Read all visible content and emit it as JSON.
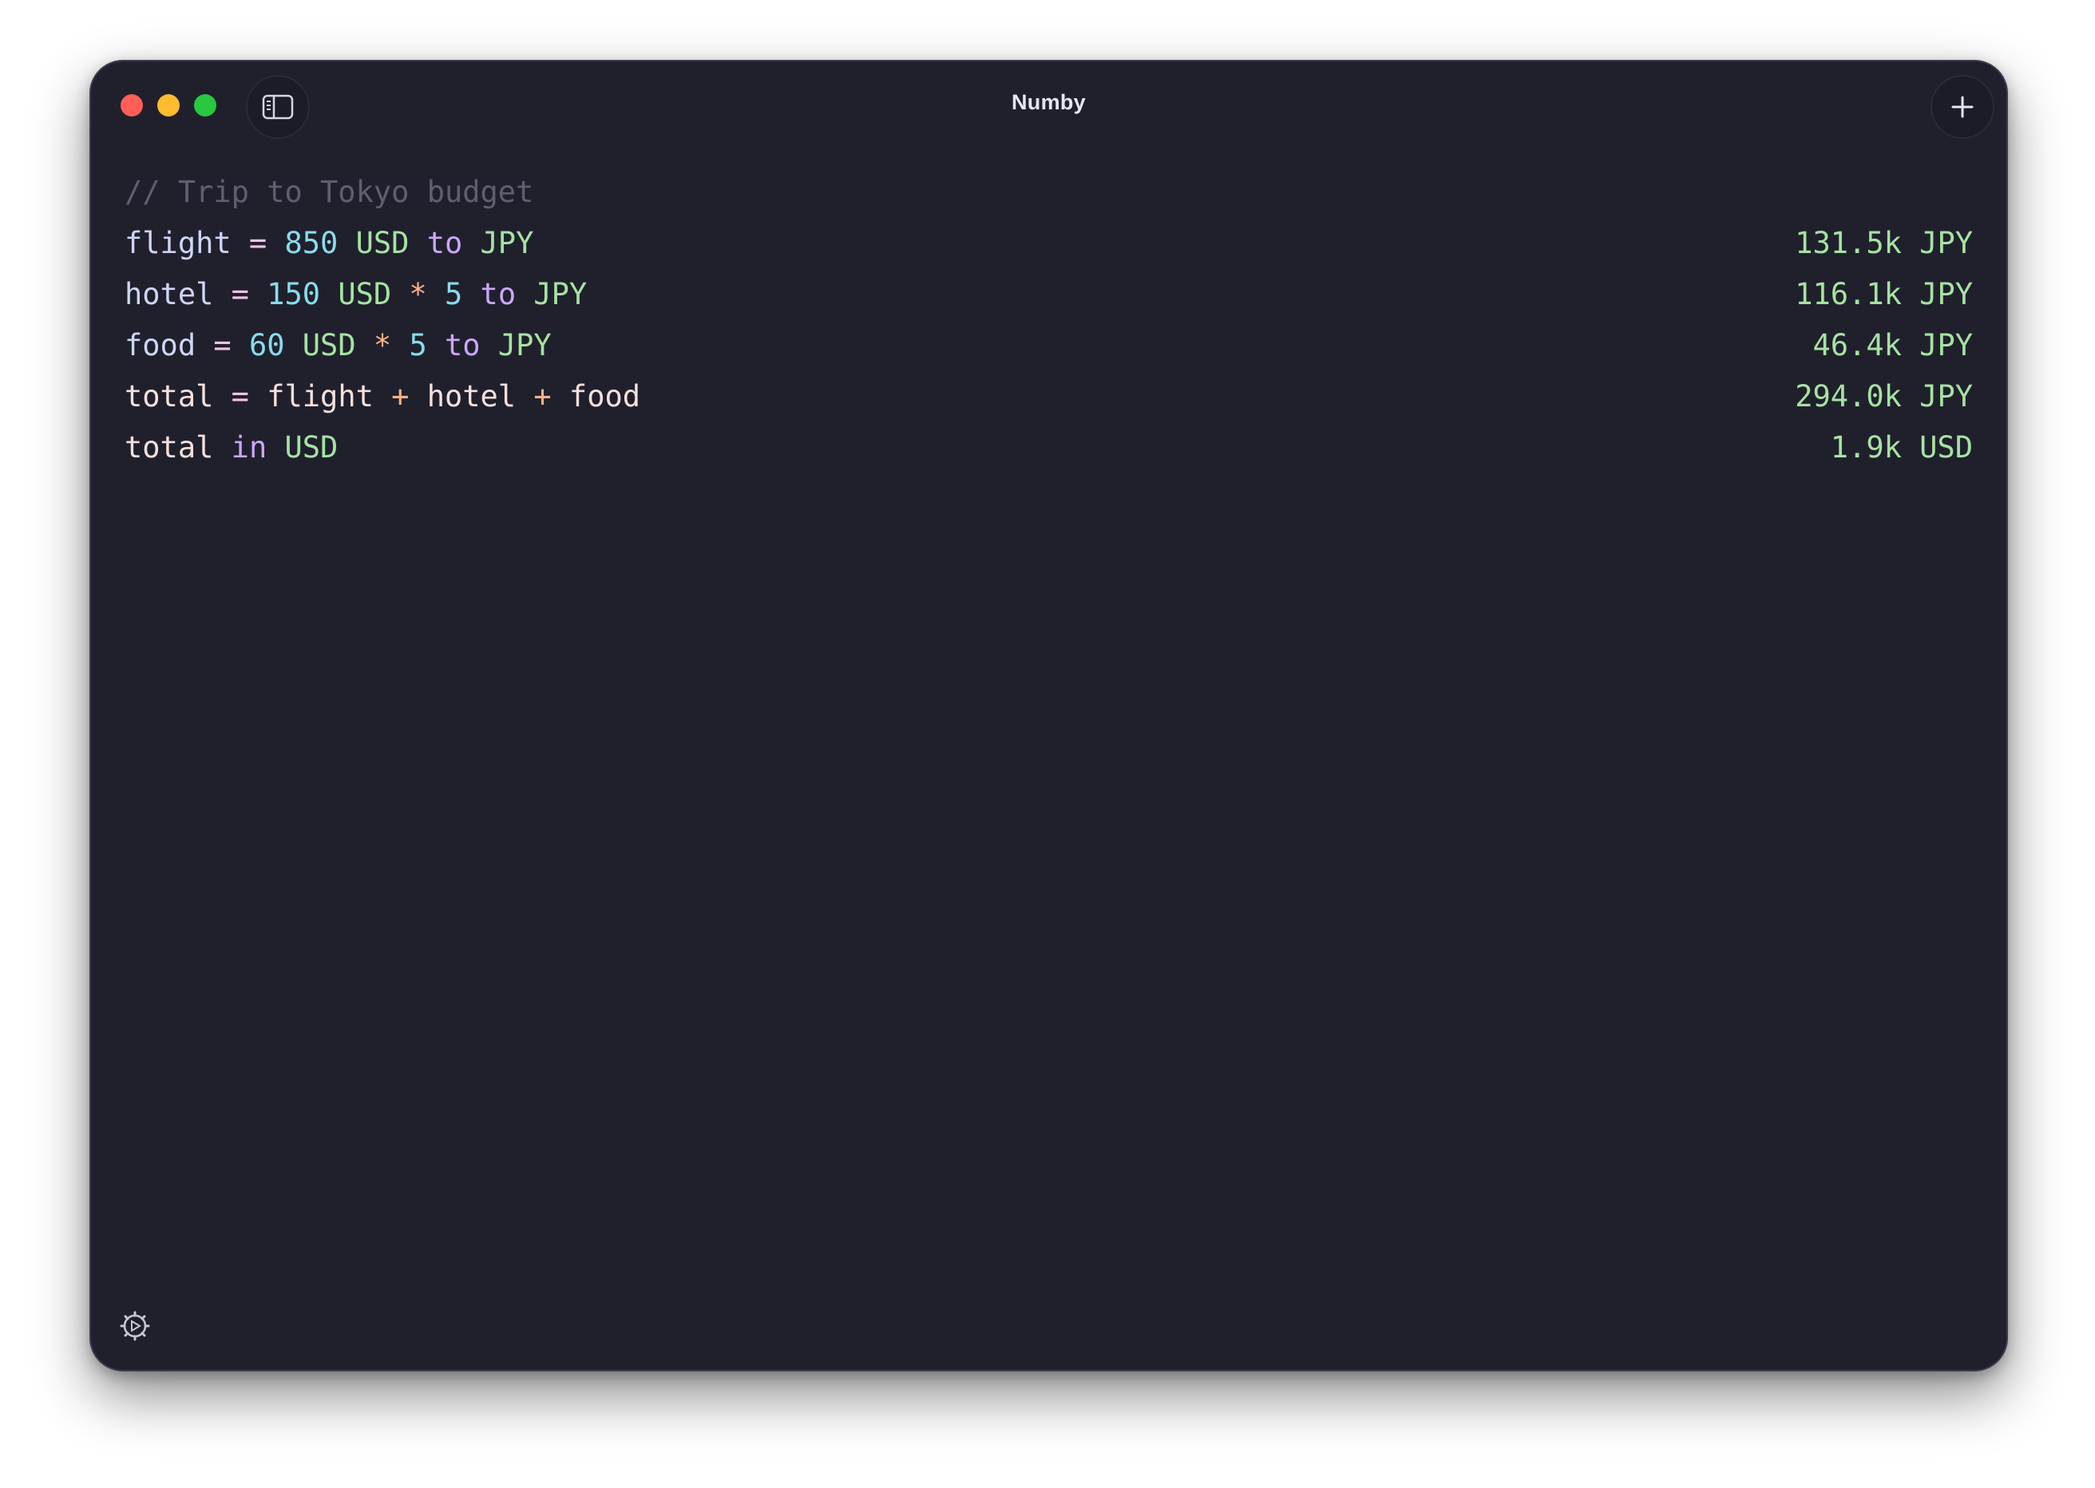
{
  "window": {
    "title": "Numby"
  },
  "editor": {
    "comment": "// Trip to Tokyo budget",
    "lines": [
      {
        "tokens": [
          {
            "t": "flight",
            "c": "var"
          },
          {
            "t": " = ",
            "c": "eq"
          },
          {
            "t": "850",
            "c": "num"
          },
          {
            "t": " USD",
            "c": "unit"
          },
          {
            "t": " to",
            "c": "kw"
          },
          {
            "t": " JPY",
            "c": "unit"
          }
        ],
        "result": "131.5k JPY"
      },
      {
        "tokens": [
          {
            "t": "hotel",
            "c": "var"
          },
          {
            "t": " = ",
            "c": "eq"
          },
          {
            "t": "150",
            "c": "num"
          },
          {
            "t": " USD",
            "c": "unit"
          },
          {
            "t": " * ",
            "c": "op"
          },
          {
            "t": "5",
            "c": "num"
          },
          {
            "t": " to",
            "c": "kw"
          },
          {
            "t": " JPY",
            "c": "unit"
          }
        ],
        "result": "116.1k JPY"
      },
      {
        "tokens": [
          {
            "t": "food",
            "c": "var"
          },
          {
            "t": " = ",
            "c": "eq"
          },
          {
            "t": "60",
            "c": "num"
          },
          {
            "t": " USD",
            "c": "unit"
          },
          {
            "t": " * ",
            "c": "op"
          },
          {
            "t": "5",
            "c": "num"
          },
          {
            "t": " to",
            "c": "kw"
          },
          {
            "t": " JPY",
            "c": "unit"
          }
        ],
        "result": "46.4k JPY"
      },
      {
        "tokens": [
          {
            "t": "total",
            "c": "var2"
          },
          {
            "t": " = ",
            "c": "eq"
          },
          {
            "t": "flight",
            "c": "var2"
          },
          {
            "t": " + ",
            "c": "op"
          },
          {
            "t": "hotel",
            "c": "var2"
          },
          {
            "t": " + ",
            "c": "op"
          },
          {
            "t": "food",
            "c": "var2"
          }
        ],
        "result": "294.0k JPY"
      },
      {
        "tokens": [
          {
            "t": "total",
            "c": "var2"
          },
          {
            "t": " in",
            "c": "kw"
          },
          {
            "t": " USD",
            "c": "unit"
          }
        ],
        "result": "1.9k USD"
      }
    ]
  },
  "icons": {
    "sidebar_toggle": "sidebar-icon",
    "new_tab": "plus-icon",
    "settings": "gear-icon"
  },
  "colors": {
    "background": "#20202d",
    "result": "#a6e3a1",
    "number": "#89dceb",
    "keyword": "#cba6f7",
    "operator": "#fab387",
    "comment": "#5c6070"
  }
}
